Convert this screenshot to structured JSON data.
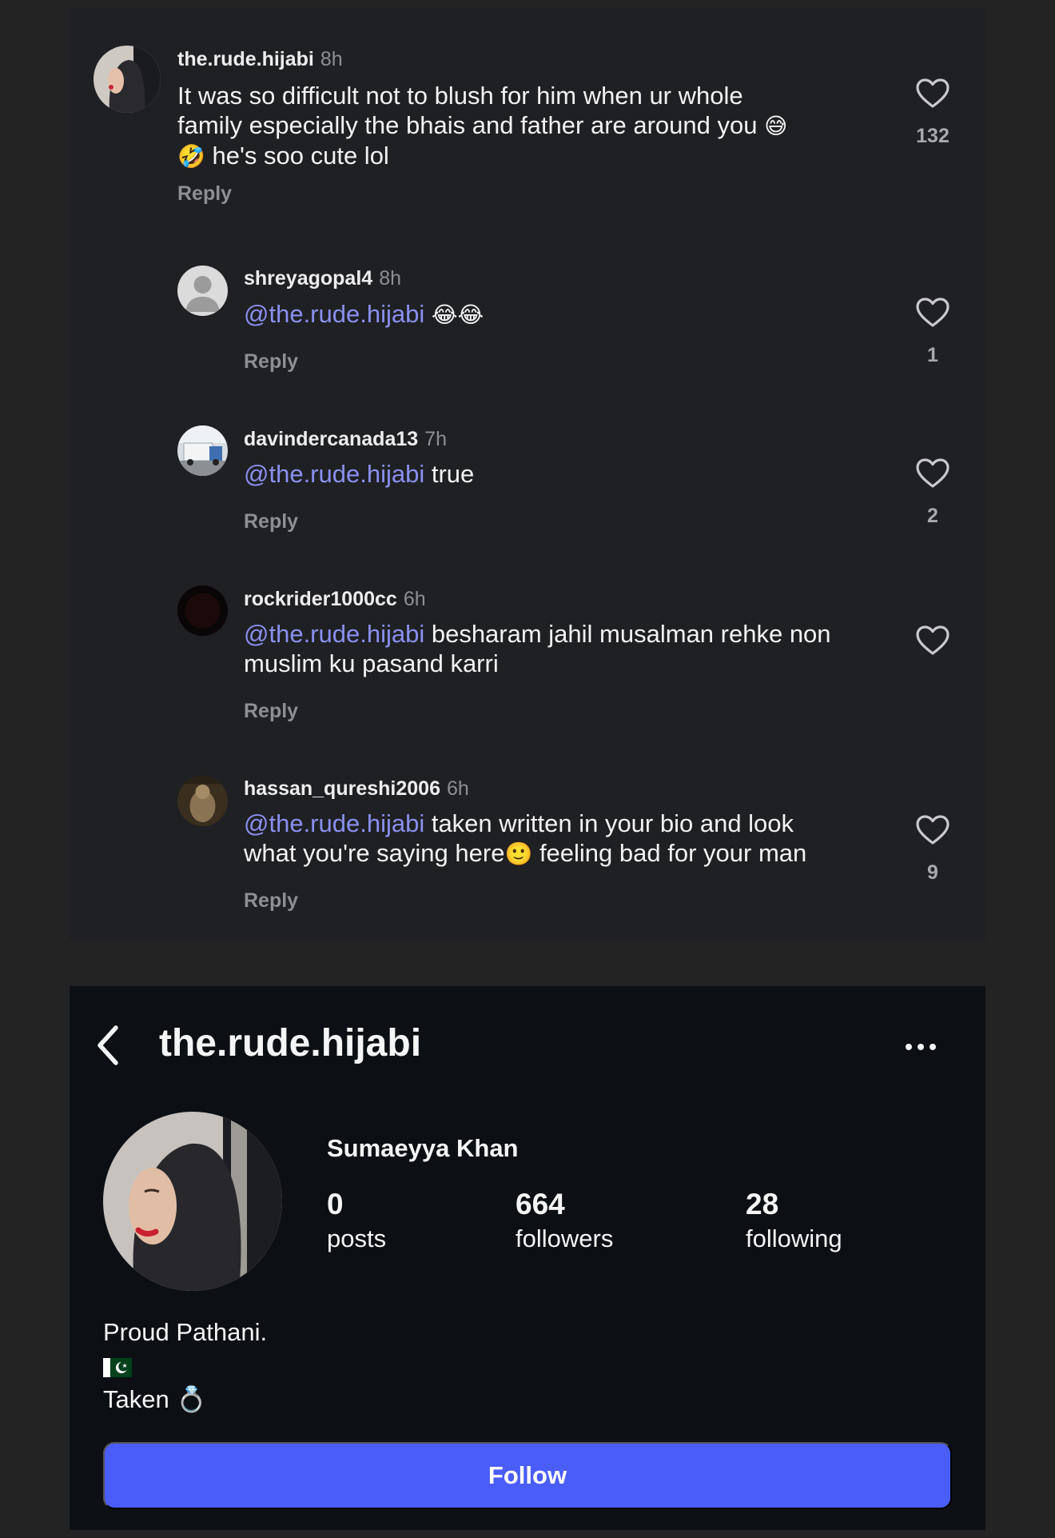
{
  "comments": [
    {
      "username": "the.rude.hijabi",
      "time": "8h",
      "text_line1": "It was so difficult not to blush for him when ur whole",
      "text_line2": "family especially the bhais and father are around you",
      "emoji_a": "😅",
      "emoji_b": "🤣",
      "text_line3": " he's soo cute lol",
      "reply": "Reply",
      "likes": "132"
    },
    {
      "username": "shreyagopal4",
      "time": "8h",
      "mention": "@the.rude.hijabi",
      "emoji": "😂😂",
      "reply": "Reply",
      "likes": "1"
    },
    {
      "username": "davindercanada13",
      "time": "7h",
      "mention": "@the.rude.hijabi",
      "text": " true",
      "reply": "Reply",
      "likes": "2"
    },
    {
      "username": "rockrider1000cc",
      "time": "6h",
      "mention": "@the.rude.hijabi",
      "text_line1": " besharam jahil musalman rehke non",
      "text_line2": "muslim ku pasand karri",
      "reply": "Reply"
    },
    {
      "username": "hassan_qureshi2006",
      "time": "6h",
      "mention": "@the.rude.hijabi",
      "text_line1": " taken written in your bio and look",
      "text_line2a": "what you're saying here",
      "emoji": "🙂",
      "text_line2b": " feeling bad for your man",
      "reply": "Reply",
      "likes": "9"
    }
  ],
  "profile": {
    "username": "the.rude.hijabi",
    "full_name": "Sumaeyya Khan",
    "stats": [
      {
        "value": "0",
        "label": "posts"
      },
      {
        "value": "664",
        "label": "followers"
      },
      {
        "value": "28",
        "label": "following"
      }
    ],
    "bio_line1": "Proud Pathani.",
    "bio_line3": "Taken",
    "bio_ring": "💍",
    "follow_label": "Follow"
  },
  "colors": {
    "mention": "#8b90f0",
    "follow_button": "#4a5df9",
    "comments_bg": "#1f2023",
    "profile_bg": "#0c1014"
  },
  "icons": [
    "heart-icon",
    "back-chevron-icon",
    "more-options-icon",
    "pakistan-flag-icon"
  ]
}
